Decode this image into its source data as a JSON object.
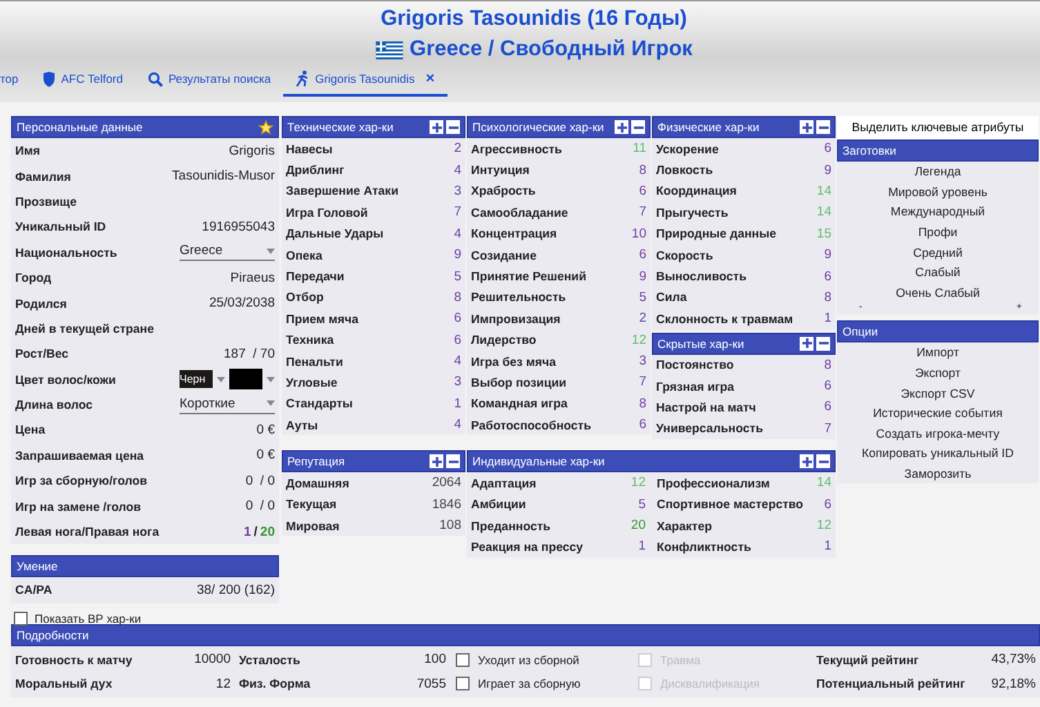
{
  "header": {
    "title": "Grigoris Tasounidis (16 Годы)",
    "subtitle": "Greece / Свободный Игрок"
  },
  "tabs": [
    {
      "label": "тор",
      "kind": "plain",
      "selected": false
    },
    {
      "label": "AFC Telford",
      "kind": "club",
      "selected": false
    },
    {
      "label": "Результаты поиска",
      "kind": "search",
      "selected": false
    },
    {
      "label": "Grigoris Tasounidis",
      "kind": "player",
      "selected": true,
      "close": "×"
    }
  ],
  "personal": {
    "title": "Персональные данные",
    "fields": [
      {
        "kind": "text",
        "label": "Имя",
        "value": "Grigoris"
      },
      {
        "kind": "text",
        "label": "Фамилия",
        "value": "Tasounidis-Musor"
      },
      {
        "kind": "text",
        "label": "Прозвище"
      },
      {
        "kind": "text",
        "label": "Уникальный ID",
        "value": "1916955043"
      },
      {
        "kind": "select",
        "label": "Национальность",
        "value": "Greece"
      },
      {
        "kind": "text",
        "label": "Город",
        "value": "Piraeus"
      },
      {
        "kind": "text",
        "label": "Родился",
        "value": "25/03/2038"
      },
      {
        "kind": "text",
        "label": "Дней в текущей стране"
      },
      {
        "kind": "text",
        "label": "Рост/Вес",
        "value": "187  / 70"
      },
      {
        "kind": "swatch",
        "label": "Цвет волос/кожи",
        "value": "Черн",
        "color": "#1c1a18",
        "skin": {
          "color": "#000000"
        }
      },
      {
        "kind": "select",
        "label": "Длина волос",
        "value": "Короткие"
      },
      {
        "kind": "text",
        "label": "Цена",
        "value": "0 €"
      },
      {
        "kind": "text",
        "label": "Запрашиваемая цена",
        "value": "0 €"
      },
      {
        "kind": "text",
        "label": "Игр за сборную/голов",
        "value": "0  / 0"
      },
      {
        "kind": "text",
        "label": "Игр на замене /голов",
        "value": "0  / 0"
      },
      {
        "kind": "feet",
        "label": "Левая нога/Правая нога",
        "left": {
          "value": "1",
          "color": "#6b3fa0"
        },
        "sep": "/",
        "right": {
          "value": "20",
          "color": "#2f9a2f"
        }
      }
    ]
  },
  "skill": {
    "title": "Умение",
    "label": "CA/PA",
    "value": "38/ 200 (162)"
  },
  "show_bp": {
    "label": "Показать ВР хар-ки",
    "checked": false
  },
  "technical": {
    "title": "Технические хар-ки",
    "items": [
      {
        "label": "Навесы",
        "value": "2",
        "color": "#6b3fa0"
      },
      {
        "label": "Дриблинг",
        "value": "4",
        "color": "#6b3fa0"
      },
      {
        "label": "Завершение Атаки",
        "value": "3",
        "color": "#6b3fa0"
      },
      {
        "label": "Игра Головой",
        "value": "7",
        "color": "#6b3fa0"
      },
      {
        "label": "Дальные Удары",
        "value": "4",
        "color": "#6b3fa0"
      },
      {
        "label": "Опека",
        "value": "9",
        "color": "#6b3fa0"
      },
      {
        "label": "Передачи",
        "value": "5",
        "color": "#6b3fa0"
      },
      {
        "label": "Отбор",
        "value": "8",
        "color": "#6b3fa0"
      },
      {
        "label": "Прием мяча",
        "value": "6",
        "color": "#6b3fa0"
      },
      {
        "label": "Техника",
        "value": "6",
        "color": "#6b3fa0"
      },
      {
        "label": "Пенальти",
        "value": "4",
        "color": "#6b3fa0"
      },
      {
        "label": "Угловые",
        "value": "3",
        "color": "#6b3fa0"
      },
      {
        "label": "Стандарты",
        "value": "1",
        "color": "#6b3fa0"
      },
      {
        "label": "Ауты",
        "value": "4",
        "color": "#6b3fa0"
      }
    ]
  },
  "mental": {
    "title": "Психологические хар-ки",
    "items": [
      {
        "label": "Агрессивность",
        "value": "11",
        "color": "#5cbf6a"
      },
      {
        "label": "Интуиция",
        "value": "8",
        "color": "#6b3fa0"
      },
      {
        "label": "Храбрость",
        "value": "6",
        "color": "#6b3fa0"
      },
      {
        "label": "Самообладание",
        "value": "7",
        "color": "#6b3fa0"
      },
      {
        "label": "Концентрация",
        "value": "10",
        "color": "#6b3fa0"
      },
      {
        "label": "Созидание",
        "value": "6",
        "color": "#6b3fa0"
      },
      {
        "label": "Принятие Решений",
        "value": "9",
        "color": "#6b3fa0"
      },
      {
        "label": "Решительность",
        "value": "5",
        "color": "#6b3fa0"
      },
      {
        "label": "Импровизация",
        "value": "2",
        "color": "#6b3fa0"
      },
      {
        "label": "Лидерство",
        "value": "12",
        "color": "#5cbf6a"
      },
      {
        "label": "Игра без мяча",
        "value": "3",
        "color": "#6b3fa0"
      },
      {
        "label": "Выбор позиции",
        "value": "7",
        "color": "#6b3fa0"
      },
      {
        "label": "Командная игра",
        "value": "8",
        "color": "#6b3fa0"
      },
      {
        "label": "Работоспособность",
        "value": "6",
        "color": "#6b3fa0"
      }
    ]
  },
  "physical": {
    "title": "Физические хар-ки",
    "items": [
      {
        "label": "Ускорение",
        "value": "6",
        "color": "#6b3fa0"
      },
      {
        "label": "Ловкость",
        "value": "9",
        "color": "#6b3fa0"
      },
      {
        "label": "Координация",
        "value": "14",
        "color": "#5cbf6a"
      },
      {
        "label": "Прыгучесть",
        "value": "14",
        "color": "#5cbf6a"
      },
      {
        "label": "Природные данные",
        "value": "15",
        "color": "#5cbf6a"
      },
      {
        "label": "Скорость",
        "value": "9",
        "color": "#6b3fa0"
      },
      {
        "label": "Выносливость",
        "value": "6",
        "color": "#6b3fa0"
      },
      {
        "label": "Сила",
        "value": "8",
        "color": "#6b3fa0"
      },
      {
        "label": "Склонность к травмам",
        "value": "1",
        "color": "#6b3fa0"
      }
    ]
  },
  "hidden": {
    "title": "Скрытые хар-ки",
    "items": [
      {
        "label": "Постоянство",
        "value": "8",
        "color": "#6b3fa0"
      },
      {
        "label": "Грязная игра",
        "value": "6",
        "color": "#6b3fa0"
      },
      {
        "label": "Настрой на матч",
        "value": "6",
        "color": "#6b3fa0"
      },
      {
        "label": "Универсальность",
        "value": "7",
        "color": "#6b3fa0"
      }
    ]
  },
  "reputation": {
    "title": "Репутация",
    "items": [
      {
        "label": "Домашняя",
        "value": "2064",
        "color": "#444444"
      },
      {
        "label": "Текущая",
        "value": "1846",
        "color": "#444444"
      },
      {
        "label": "Мировая",
        "value": "108",
        "color": "#444444"
      }
    ]
  },
  "individual": {
    "title": "Индивидуальные хар-ки",
    "items": [
      {
        "label": "Адаптация",
        "value": "12",
        "color": "#5cbf6a"
      },
      {
        "label": "Амбиции",
        "value": "5",
        "color": "#6b3fa0"
      },
      {
        "label": "Преданность",
        "value": "20",
        "color": "#2f9a2f"
      },
      {
        "label": "Реакция на прессу",
        "value": "1",
        "color": "#6b3fa0"
      }
    ],
    "items2": [
      {
        "label": "Профессионализм",
        "value": "14",
        "color": "#5cbf6a"
      },
      {
        "label": "Спортивное мастерство",
        "value": "6",
        "color": "#6b3fa0"
      },
      {
        "label": "Характер",
        "value": "12",
        "color": "#5cbf6a"
      },
      {
        "label": "Конфликтность",
        "value": "1",
        "color": "#6b3fa0"
      }
    ]
  },
  "highlight_button": "Выделить ключевые атрибуты",
  "presets": {
    "title": "Заготовки",
    "items": [
      "Легенда",
      "Мировой уровень",
      "Международный",
      "Профи",
      "Средний",
      "Слабый",
      "Очень Слабый"
    ],
    "scale": [
      "-",
      "+"
    ]
  },
  "options": {
    "title": "Опции",
    "items": [
      "Импорт",
      "Экспорт",
      "Экспорт CSV",
      "Исторические события",
      "Создать игрока-мечту",
      "Копировать уникальный ID",
      "Заморозить"
    ]
  },
  "details": {
    "title": "Подробности",
    "columns": [
      {
        "kind": "pairs",
        "items": [
          {
            "label": "Готовность к матчу",
            "value": "10000"
          },
          {
            "label": "Моральный дух",
            "value": "12"
          }
        ]
      },
      {
        "kind": "pairs",
        "items": [
          {
            "label": "Усталость",
            "value": "100"
          },
          {
            "label": "Физ. Форма",
            "value": "7055"
          }
        ]
      },
      {
        "kind": "checks",
        "items": [
          {
            "label": "Уходит из сборной",
            "checked": false,
            "disabled": false
          },
          {
            "label": "Играет за сборную",
            "checked": false,
            "disabled": false
          }
        ]
      },
      {
        "kind": "checks",
        "items": [
          {
            "label": "Травма",
            "checked": false,
            "disabled": true
          },
          {
            "label": "Дисквалификация",
            "checked": false,
            "disabled": true
          }
        ]
      },
      {
        "kind": "pairs",
        "items": [
          {
            "label": "Текущий рейтинг",
            "value": "43,73%"
          },
          {
            "label": "Потенциальный рейтинг",
            "value": "92,18%"
          }
        ]
      }
    ]
  }
}
